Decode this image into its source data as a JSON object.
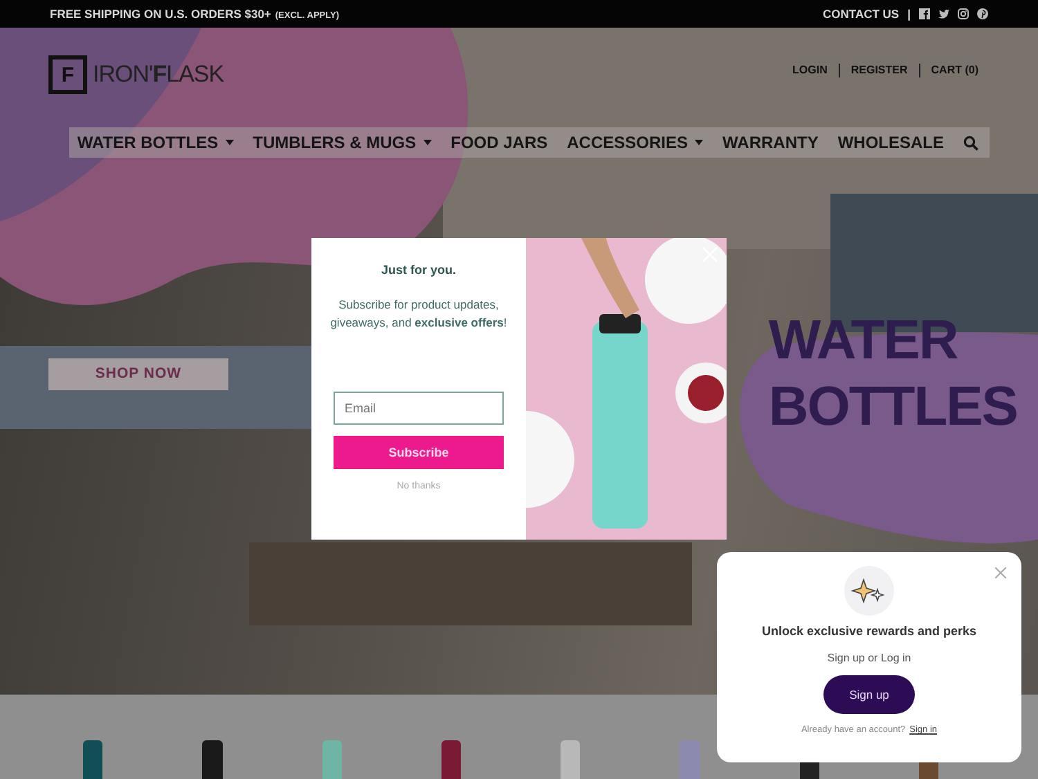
{
  "announcement": {
    "text": "FREE SHIPPING ON U.S. ORDERS $30+",
    "note": "(EXCL. APPLY)"
  },
  "top_links": {
    "contact": "CONTACT US",
    "separator": "|"
  },
  "logo": {
    "mark": "F",
    "text": "IRON'**F**LASK"
  },
  "account_links": [
    "LOGIN",
    "REGISTER",
    "CART (0)"
  ],
  "nav": [
    {
      "label": "WATER BOTTLES",
      "dropdown": true
    },
    {
      "label": "TUMBLERS & MUGS",
      "dropdown": true
    },
    {
      "label": "FOOD JARS",
      "dropdown": false
    },
    {
      "label": "ACCESSORIES",
      "dropdown": true
    },
    {
      "label": "WARRANTY",
      "dropdown": false
    },
    {
      "label": "WHOLESALE",
      "dropdown": false
    }
  ],
  "hero": {
    "button": "SHOP NOW",
    "headline": [
      "WATER",
      "BOTTLES"
    ]
  },
  "popup": {
    "heading": "Just for you.",
    "body": "Subscribe for product updates, giveaways, and **exclusive offers**!",
    "email_placeholder": "Email",
    "button": "Subscribe",
    "decline": "No thanks"
  },
  "rewards": {
    "title": "Unlock exclusive rewards and perks",
    "subtitle": "Sign up or Log in",
    "button": "Sign up",
    "prompt": "Already have an account?",
    "link": "Sign in"
  },
  "products": [
    {
      "color": "#0f4f55"
    },
    {
      "color": "#1a1a1a"
    },
    {
      "color": "#6fb5a6"
    },
    {
      "color": "#7a1a34"
    },
    {
      "color": "#b8b8b8"
    },
    {
      "color": "#8d8ab0"
    },
    {
      "color": "#222222"
    },
    {
      "color": "#6a4a30"
    }
  ]
}
